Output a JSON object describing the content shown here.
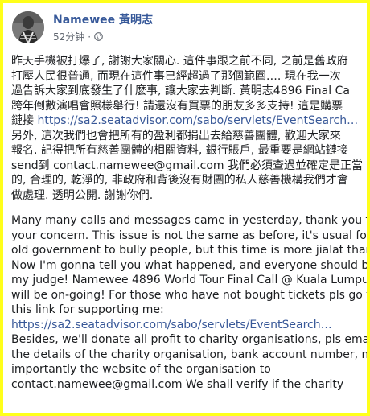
{
  "post": {
    "author_name": "Namewee 黃明志",
    "timestamp": "52分钟",
    "separator": "·",
    "privacy_icon": "globe-icon",
    "chinese_lines": [
      "昨天手機被打爆了, 謝謝大家關心. 這件事跟之前不同, 之前是舊政府",
      "打壓人民很普通, 而現在這件事已經超過了那個範圍…. 現在我一次",
      "過告訴大家到底發生了什麽事, 讓大家去判斷. 黃明志4896 Final Ca",
      "跨年倒數演唱會照樣舉行! 請還沒有買票的朋友多多支持! 這是購票"
    ],
    "chinese_link_prefix": "鏈接 ",
    "chinese_link": "https://sa2.seatadvisor.com/sabo/servlets/EventSearch…",
    "chinese_lines_2": [
      "另外, 這次我們也會把所有的盈利都捐出去給慈善團體, 歡迎大家來",
      "報名. 記得把所有慈善團體的相關資料, 銀行賬戶, 最重要是網站鏈接",
      "send到 contact.namewee@gmail.com 我們必須查過並確定是正當",
      "的, 合理的, 乾淨的, 非政府和背後沒有財團的私人慈善機構我們才會",
      "做處理. 透明公開. 謝謝你們."
    ],
    "english_lines": [
      "Many many calls and messages came in yesterday, thank you for",
      "your concern. This issue is not the same as before, it's usual for the",
      "old government to bully people, but this time is more jialat than that.",
      "Now I'm gonna tell you what happened, and everyone should be",
      "my judge! Namewee 4896 World Tour Final Call @ Kuala Lumpur",
      "will be on-going! For those who have not bought tickets pls go to",
      "this link for supporting me:"
    ],
    "english_link": "https://sa2.seatadvisor.com/sabo/servlets/EventSearch…",
    "english_lines_2": [
      "Besides, we'll donate all profit to charity organisations, pls email us",
      "the details of the charity organisation, bank account number, most",
      "importantly the website of the organisation to",
      "contact.namewee@gmail.com We shall verify if the charity"
    ]
  },
  "colors": {
    "frame": "#ffff1a",
    "author": "#365899",
    "link": "#385898",
    "meta": "#616770",
    "text": "#1c1e21"
  }
}
